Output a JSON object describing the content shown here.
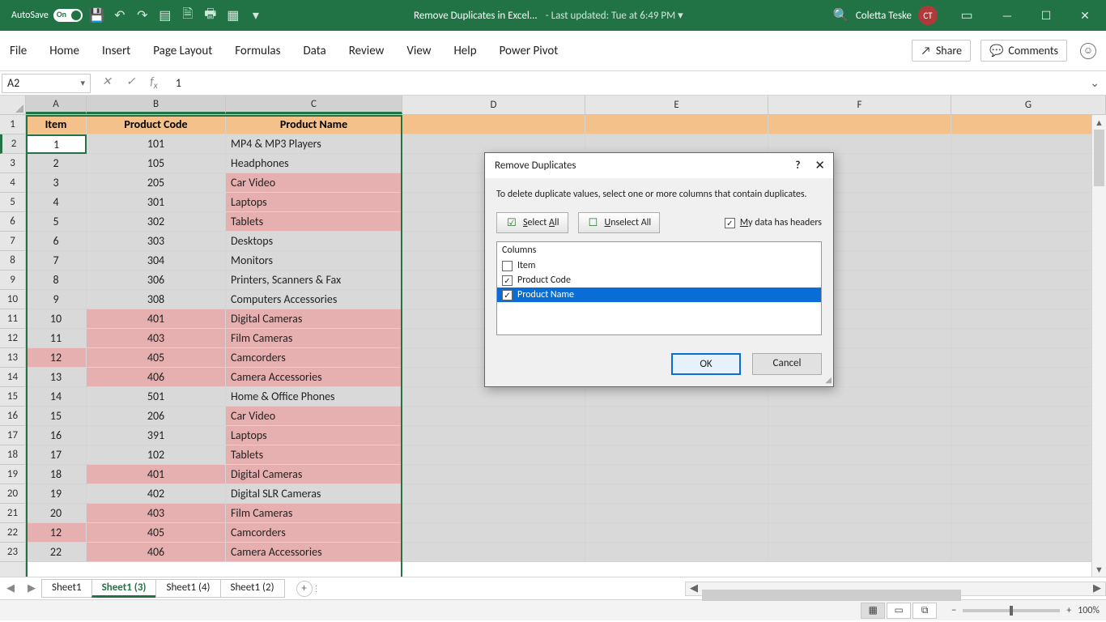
{
  "titlebar": {
    "autosave_label": "AutoSave",
    "autosave_on": "On",
    "filename": "Remove Duplicates in Excel...",
    "last_updated": "-  Last updated: Tue at 6:49 PM  ▾",
    "user_name": "Coletta Teske",
    "user_initials": "CT"
  },
  "ribbon": {
    "tabs": [
      "File",
      "Home",
      "Insert",
      "Page Layout",
      "Formulas",
      "Data",
      "Review",
      "View",
      "Help",
      "Power Pivot"
    ],
    "share": "Share",
    "comments": "Comments"
  },
  "formula_bar": {
    "name_box": "A2",
    "value": "1"
  },
  "columns": [
    "A",
    "B",
    "C",
    "D",
    "E",
    "F",
    "G"
  ],
  "header_row": {
    "A": "Item",
    "B": "Product Code",
    "C": "Product Name"
  },
  "rows": [
    {
      "n": 2,
      "A": "1",
      "B": "101",
      "C": "MP4 & MP3 Players",
      "style": ""
    },
    {
      "n": 3,
      "A": "2",
      "B": "105",
      "C": "Headphones",
      "style": ""
    },
    {
      "n": 4,
      "A": "3",
      "B": "205",
      "C": "Car Video",
      "style": "pinkC"
    },
    {
      "n": 5,
      "A": "4",
      "B": "301",
      "C": "Laptops",
      "style": "pinkC"
    },
    {
      "n": 6,
      "A": "5",
      "B": "302",
      "C": "Tablets",
      "style": "pinkC"
    },
    {
      "n": 7,
      "A": "6",
      "B": "303",
      "C": "Desktops",
      "style": ""
    },
    {
      "n": 8,
      "A": "7",
      "B": "304",
      "C": "Monitors",
      "style": ""
    },
    {
      "n": 9,
      "A": "8",
      "B": "306",
      "C": "Printers, Scanners & Fax",
      "style": ""
    },
    {
      "n": 10,
      "A": "9",
      "B": "308",
      "C": "Computers Accessories",
      "style": ""
    },
    {
      "n": 11,
      "A": "10",
      "B": "401",
      "C": "Digital Cameras",
      "style": "pink"
    },
    {
      "n": 12,
      "A": "11",
      "B": "403",
      "C": "Film Cameras",
      "style": "pink"
    },
    {
      "n": 13,
      "A": "12",
      "B": "405",
      "C": "Camcorders",
      "style": "pinkA"
    },
    {
      "n": 14,
      "A": "13",
      "B": "406",
      "C": "Camera Accessories",
      "style": "pink"
    },
    {
      "n": 15,
      "A": "14",
      "B": "501",
      "C": "Home & Office Phones",
      "style": ""
    },
    {
      "n": 16,
      "A": "15",
      "B": "206",
      "C": "Car Video",
      "style": "pinkC"
    },
    {
      "n": 17,
      "A": "16",
      "B": "391",
      "C": "Laptops",
      "style": "pinkC"
    },
    {
      "n": 18,
      "A": "17",
      "B": "102",
      "C": "Tablets",
      "style": "pinkC"
    },
    {
      "n": 19,
      "A": "18",
      "B": "401",
      "C": "Digital Cameras",
      "style": "pink"
    },
    {
      "n": 20,
      "A": "19",
      "B": "402",
      "C": "Digital SLR Cameras",
      "style": ""
    },
    {
      "n": 21,
      "A": "20",
      "B": "403",
      "C": "Film Cameras",
      "style": "pink"
    },
    {
      "n": 22,
      "A": "12",
      "B": "405",
      "C": "Camcorders",
      "style": "pinkA"
    },
    {
      "n": 23,
      "A": "22",
      "B": "406",
      "C": "Camera Accessories",
      "style": "pink"
    }
  ],
  "sheet_tabs": [
    "Sheet1",
    "Sheet1 (3)",
    "Sheet1 (4)",
    "Sheet1 (2)"
  ],
  "active_sheet": 1,
  "zoom": "100%",
  "dialog": {
    "title": "Remove Duplicates",
    "instruction": "To delete duplicate values, select one or more columns that contain duplicates.",
    "select_all": "Select All",
    "unselect_all": "Unselect All",
    "headers_label": "My data has headers",
    "columns_label": "Columns",
    "items": [
      {
        "label": "Item",
        "checked": false,
        "selected": false
      },
      {
        "label": "Product Code",
        "checked": true,
        "selected": false
      },
      {
        "label": "Product Name",
        "checked": true,
        "selected": true
      }
    ],
    "ok": "OK",
    "cancel": "Cancel"
  }
}
